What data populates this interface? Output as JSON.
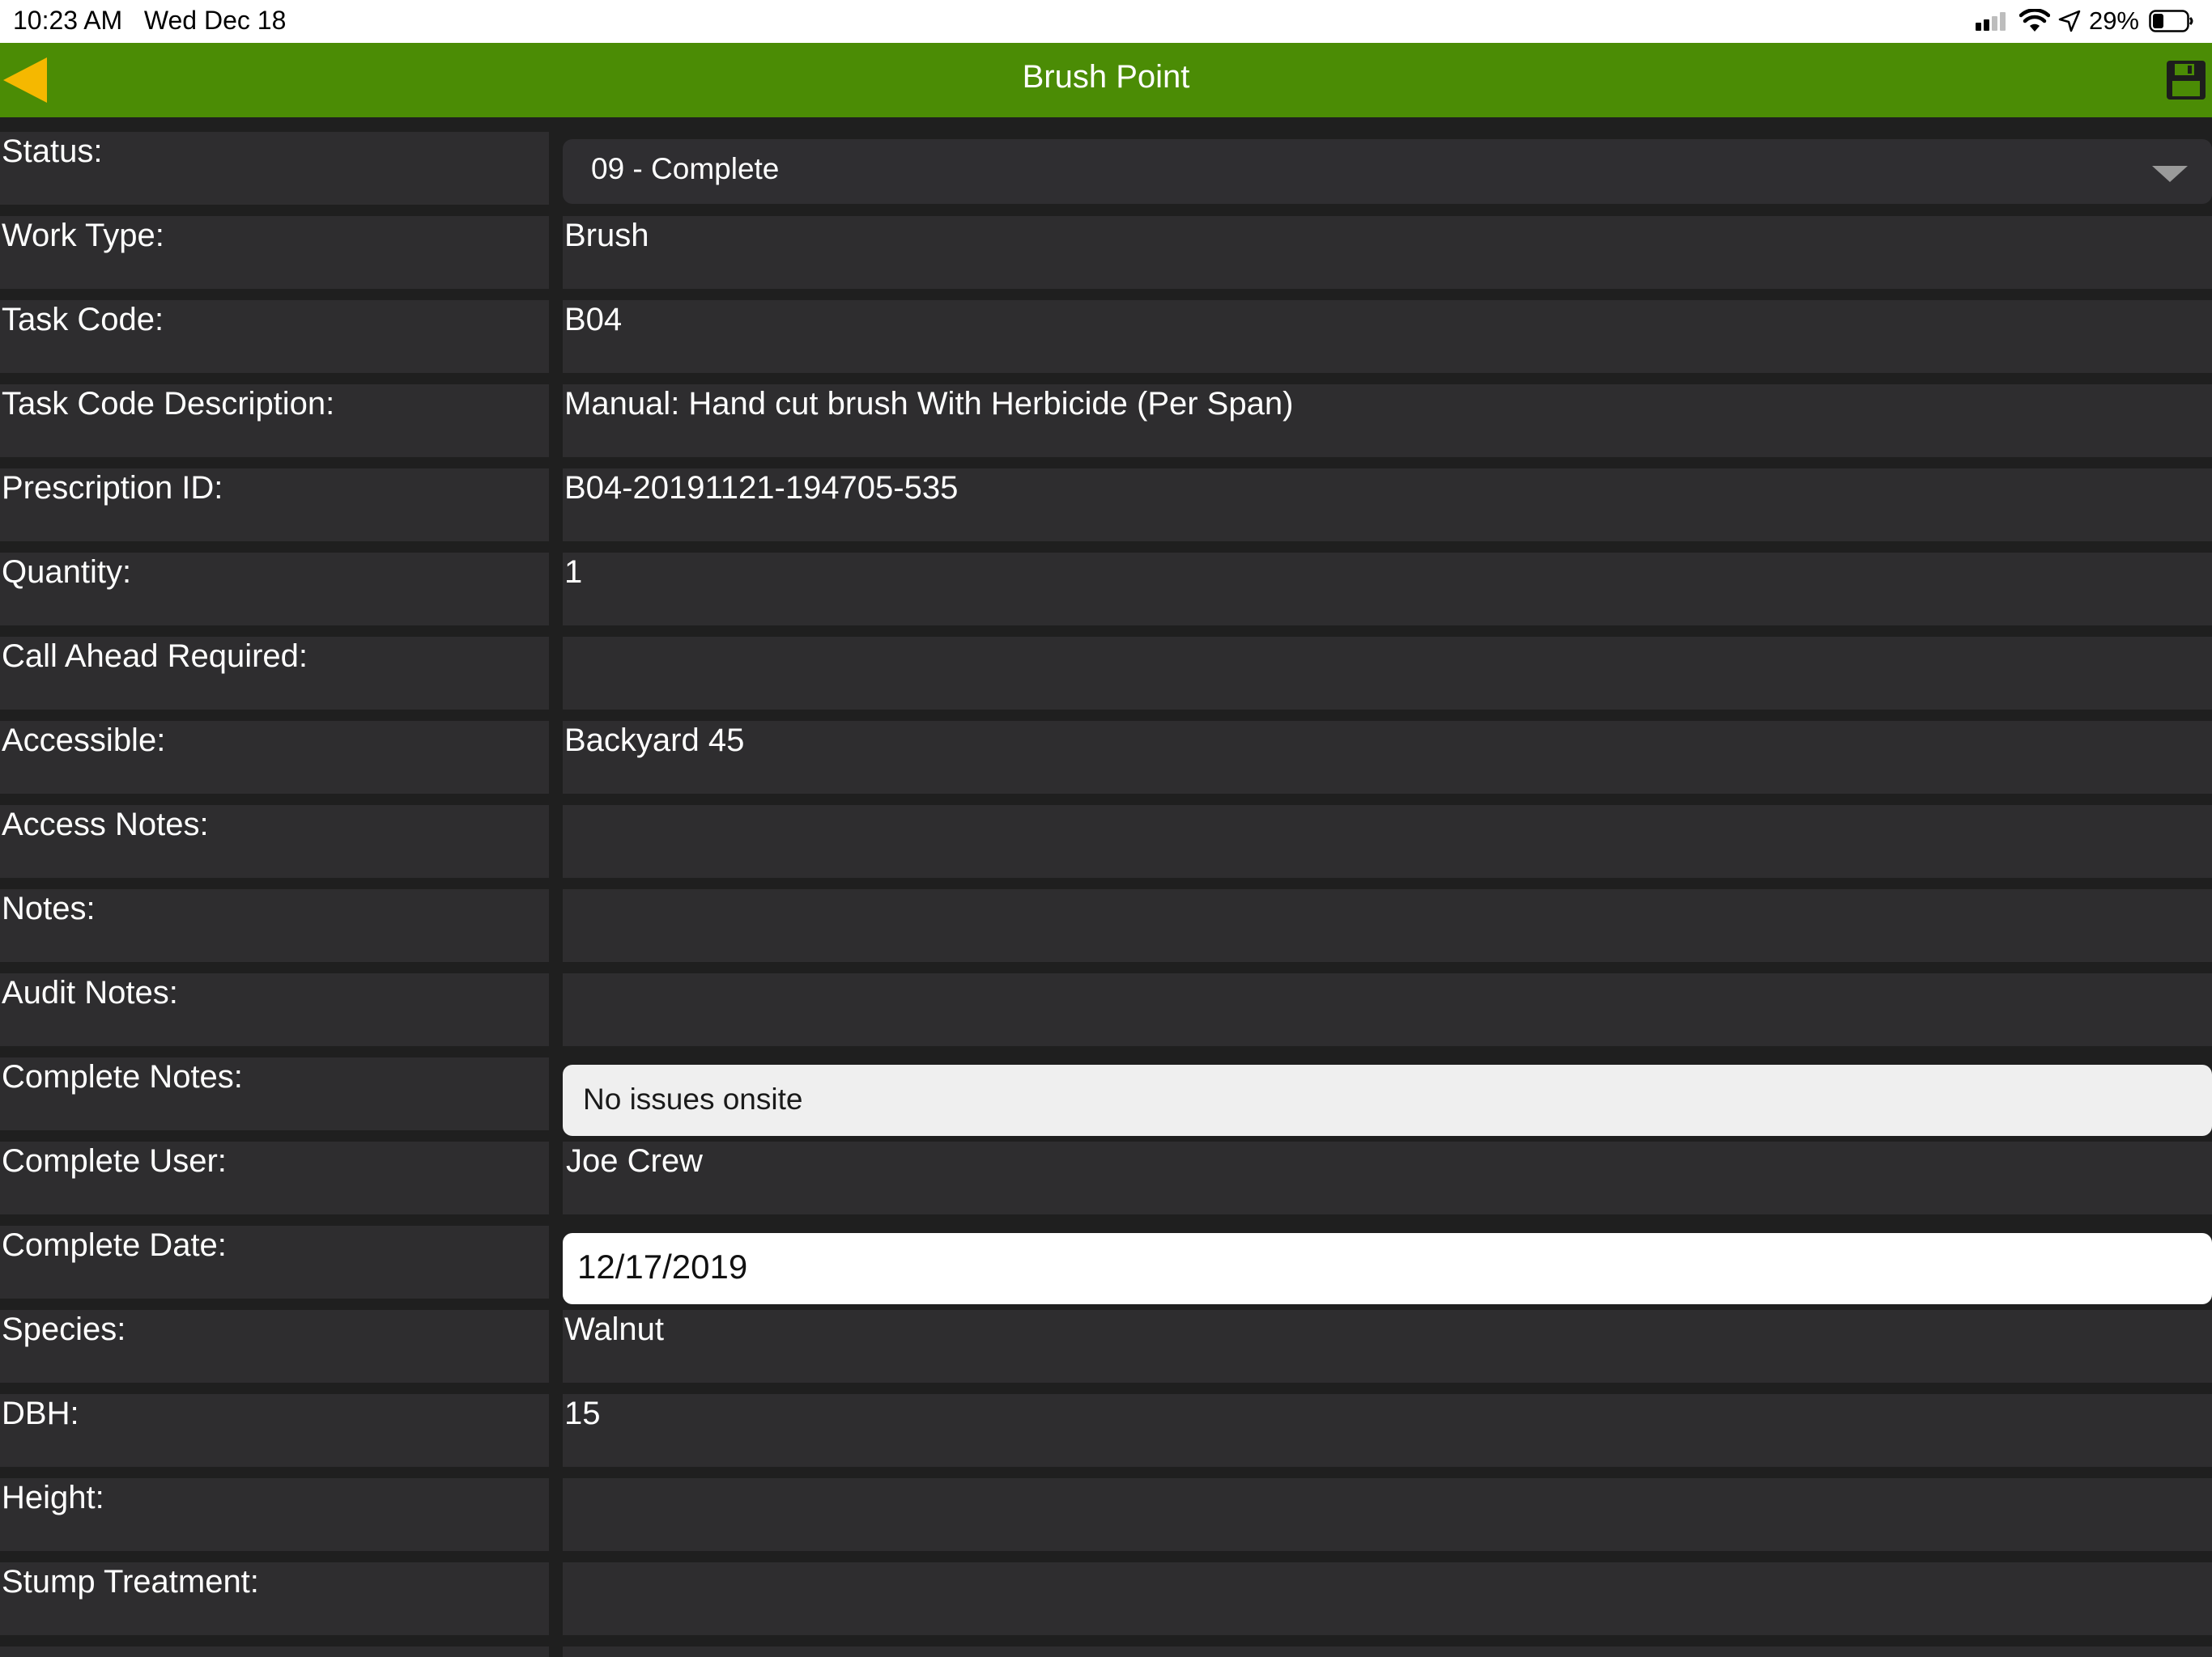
{
  "status_bar": {
    "time": "10:23 AM",
    "date": "Wed Dec 18",
    "battery": "29%",
    "icons": [
      "signal-icon",
      "wifi-icon",
      "location-arrow-icon",
      "battery-icon"
    ]
  },
  "nav": {
    "title": "Brush Point",
    "back_icon": "back-arrow-icon",
    "save_icon": "save-disk-icon",
    "colors": {
      "bar": "#4b8c05",
      "back_arrow": "#f5b800"
    }
  },
  "form": {
    "status": {
      "label": "Status:",
      "value": "09 - Complete"
    },
    "work_type": {
      "label": "Work Type:",
      "value": "Brush"
    },
    "task_code": {
      "label": "Task Code:",
      "value": "B04"
    },
    "task_code_description": {
      "label": "Task Code Description:",
      "value": "Manual: Hand cut brush With Herbicide (Per Span)"
    },
    "prescription_id": {
      "label": "Prescription ID:",
      "value": "B04-20191121-194705-535"
    },
    "quantity": {
      "label": "Quantity:",
      "value": "1"
    },
    "call_ahead_required": {
      "label": "Call Ahead Required:",
      "value": ""
    },
    "accessible": {
      "label": "Accessible:",
      "value": "Backyard 45"
    },
    "access_notes": {
      "label": "Access Notes:",
      "value": ""
    },
    "notes": {
      "label": "Notes:",
      "value": ""
    },
    "audit_notes": {
      "label": "Audit Notes:",
      "value": ""
    },
    "complete_notes": {
      "label": "Complete Notes:",
      "value": "No issues onsite"
    },
    "complete_user": {
      "label": "Complete User:",
      "value": "Joe Crew"
    },
    "complete_date": {
      "label": "Complete Date:",
      "value": "12/17/2019"
    },
    "species": {
      "label": "Species:",
      "value": "Walnut"
    },
    "dbh": {
      "label": "DBH:",
      "value": "15"
    },
    "height": {
      "label": "Height:",
      "value": ""
    },
    "stump_treatment": {
      "label": "Stump Treatment:",
      "value": ""
    }
  }
}
